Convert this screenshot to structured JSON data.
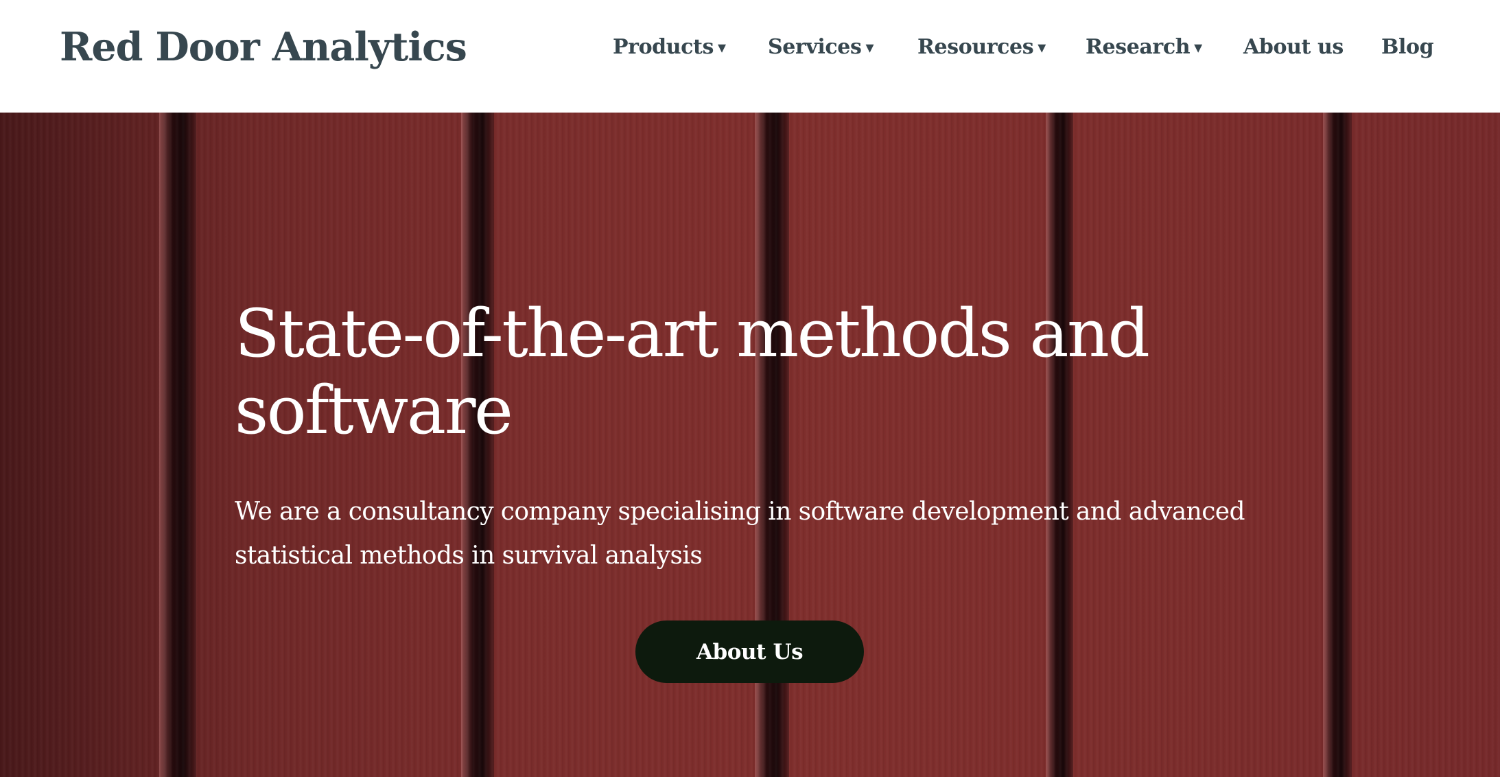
{
  "header": {
    "brand": "Red Door Analytics",
    "nav": [
      {
        "label": "Products",
        "has_dropdown": true
      },
      {
        "label": "Services",
        "has_dropdown": true
      },
      {
        "label": "Resources",
        "has_dropdown": true
      },
      {
        "label": "Research",
        "has_dropdown": true
      },
      {
        "label": "About us",
        "has_dropdown": false
      },
      {
        "label": "Blog",
        "has_dropdown": false
      }
    ],
    "dropdown_glyph": "▾"
  },
  "hero": {
    "title": "State-of-the-art methods and software",
    "subtitle": "We are a consultancy company specialising in software development and advanced statistical methods in survival analysis",
    "cta_label": "About Us",
    "background": "red-wooden-door-image"
  },
  "colors": {
    "header_bg": "#ffffff",
    "nav_text": "#37474f",
    "hero_wood": "#7f2e2c",
    "hero_text": "#ffffff",
    "cta_bg": "#0d1a0d",
    "cta_text": "#ffffff"
  }
}
